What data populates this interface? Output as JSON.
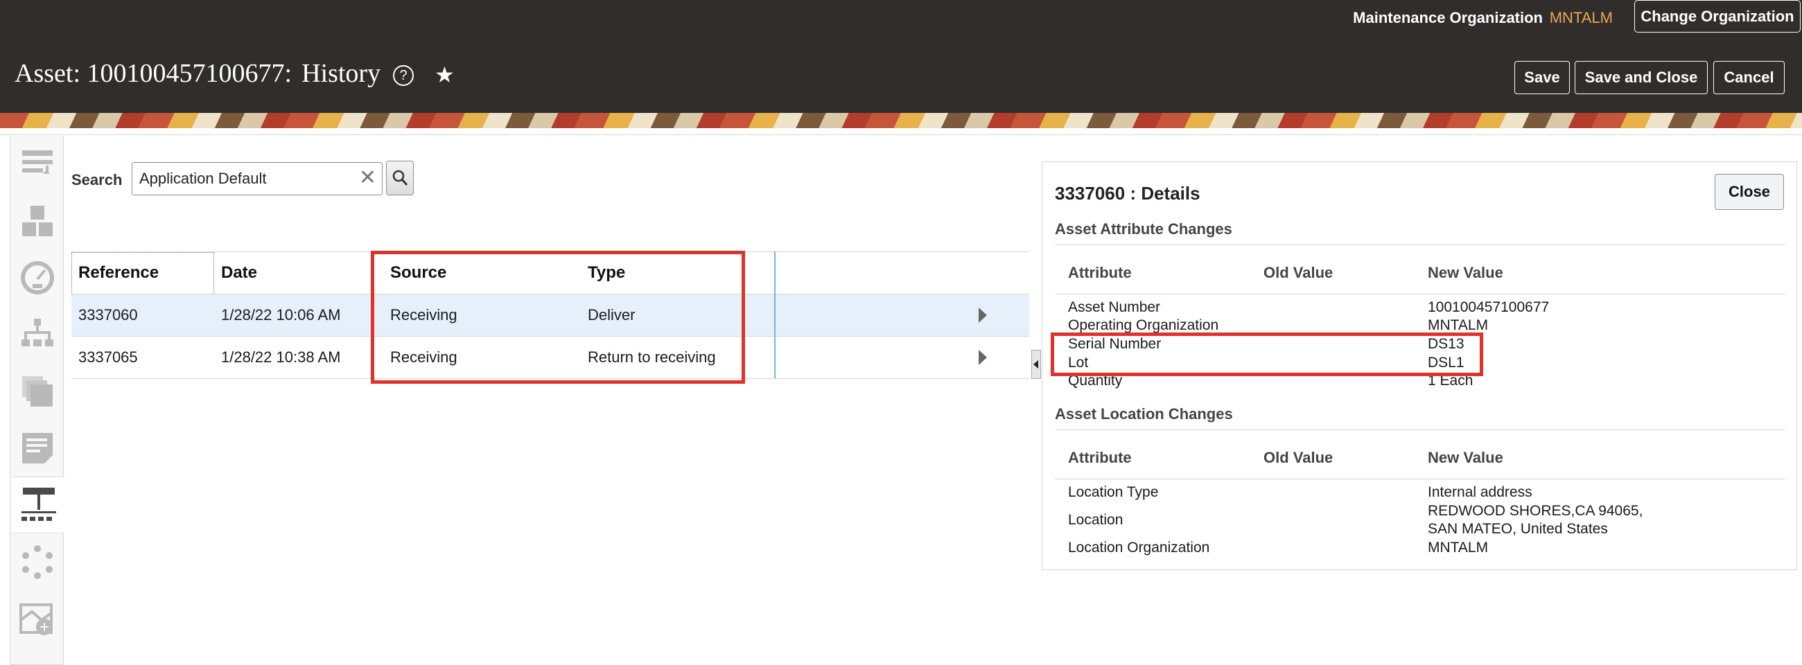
{
  "header": {
    "org_label": "Maintenance Organization",
    "org_value": "MNTALM",
    "change_org_label": "Change Organization",
    "title": "Asset: 100100457100677:",
    "subtitle": "History",
    "help_icon": "?",
    "favorite_icon": "★",
    "save_label": "Save",
    "save_close_label": "Save and Close",
    "cancel_label": "Cancel"
  },
  "rail": {
    "icons": [
      "transactions-icon",
      "asset-structure-icon",
      "meters-icon",
      "hierarchy-icon",
      "documents-icon",
      "notes-icon",
      "history-icon",
      "maintenance-cycle-icon",
      "map-icon"
    ],
    "active_index": 6
  },
  "search": {
    "label": "Search",
    "value": "Application Default",
    "clear_icon": "✕"
  },
  "history_table": {
    "columns": [
      "Reference",
      "Date",
      "Source",
      "Type"
    ],
    "rows": [
      {
        "reference": "3337060",
        "date": "1/28/22 10:06 AM",
        "source": "Receiving",
        "type": "Deliver",
        "selected": true
      },
      {
        "reference": "3337065",
        "date": "1/28/22 10:38 AM",
        "source": "Receiving",
        "type": "Return to receiving",
        "selected": false
      }
    ]
  },
  "details": {
    "title": "3337060 : Details",
    "close_label": "Close",
    "attribute_section": {
      "title": "Asset Attribute Changes",
      "columns": [
        "Attribute",
        "Old Value",
        "New Value"
      ],
      "rows": [
        {
          "attribute": "Asset Number",
          "old": "",
          "new": "100100457100677"
        },
        {
          "attribute": "Operating Organization",
          "old": "",
          "new": "MNTALM"
        },
        {
          "attribute": "Serial Number",
          "old": "",
          "new": "DS13"
        },
        {
          "attribute": "Lot",
          "old": "",
          "new": "DSL1"
        },
        {
          "attribute": "Quantity",
          "old": "",
          "new": "1 Each"
        }
      ]
    },
    "location_section": {
      "title": "Asset Location Changes",
      "columns": [
        "Attribute",
        "Old Value",
        "New Value"
      ],
      "rows": [
        {
          "attribute": "Location Type",
          "old": "",
          "new": "Internal address"
        },
        {
          "attribute": "Location",
          "old": "",
          "new_line1": "REDWOOD SHORES,CA 94065,",
          "new_line2": "SAN MATEO, United States"
        },
        {
          "attribute": "Location Organization",
          "old": "",
          "new": "MNTALM"
        }
      ]
    }
  },
  "colors": {
    "header_bg": "#312d2a",
    "org_accent": "#e8a65a",
    "highlight": "#e0322b",
    "selected_row": "#e6f0fa"
  }
}
